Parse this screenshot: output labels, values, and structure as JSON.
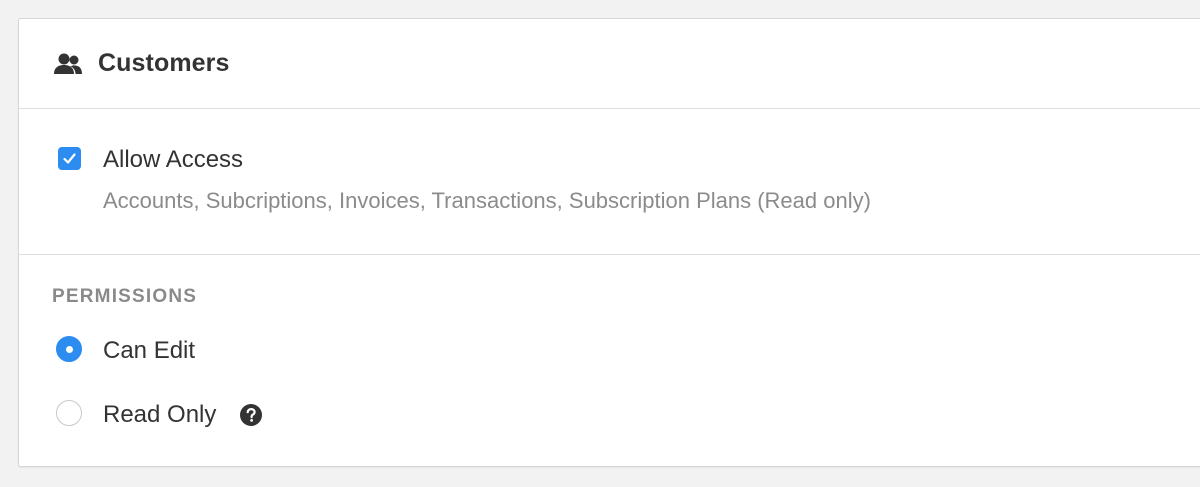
{
  "card": {
    "title": "Customers",
    "icon": "users-icon"
  },
  "access": {
    "checkbox_label": "Allow Access",
    "checked": true,
    "description": "Accounts, Subcriptions, Invoices, Transactions, Subscription Plans (Read only)"
  },
  "permissions": {
    "heading": "PERMISSIONS",
    "options": [
      {
        "label": "Can Edit",
        "selected": true
      },
      {
        "label": "Read Only",
        "selected": false,
        "help_icon": "question-circle-icon"
      }
    ]
  },
  "colors": {
    "accent": "#2d8cf0",
    "text": "#333333",
    "muted": "#8b8b8b",
    "border": "#dedede",
    "background": "#f2f2f2"
  }
}
